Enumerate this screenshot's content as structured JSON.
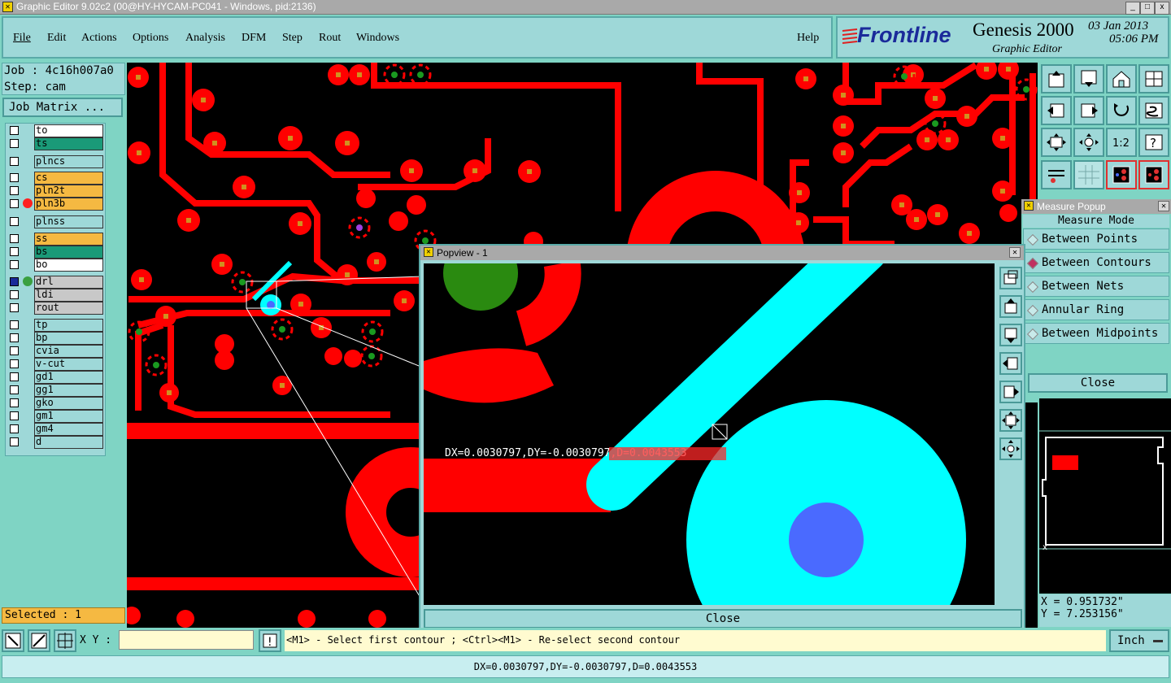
{
  "window": {
    "title": "Graphic Editor 9.02c2 (00@HY-HYCAM-PC041 - Windows, pid:2136)",
    "controls": [
      "_",
      "□",
      "x"
    ]
  },
  "menu": {
    "items": [
      "File",
      "Edit",
      "Actions",
      "Options",
      "Analysis",
      "DFM",
      "Step",
      "Rout",
      "Windows"
    ],
    "help": "Help"
  },
  "brand": {
    "logo": "Frontline",
    "product": "Genesis 2000",
    "subtitle": "Graphic Editor",
    "date": "03 Jan 2013",
    "time": "05:06 PM"
  },
  "job": {
    "job_label": "Job : 4c16h007a0",
    "step_label": "Step: cam",
    "matrix_button": "Job Matrix ..."
  },
  "layers": {
    "groups": [
      [
        {
          "name": "to",
          "color": "#ffffff"
        },
        {
          "name": "ts",
          "color": "#1a9a78"
        }
      ],
      [
        {
          "name": "plncs",
          "color": "#9ed8d8"
        }
      ],
      [
        {
          "name": "cs",
          "color": "#f5b942"
        },
        {
          "name": "pln2t",
          "color": "#f5b942"
        },
        {
          "name": "pln3b",
          "color": "#f5b942",
          "dot": "#ff2020"
        }
      ],
      [
        {
          "name": "plnss",
          "color": "#9ed8d8"
        }
      ],
      [
        {
          "name": "ss",
          "color": "#f5b942"
        },
        {
          "name": "bs",
          "color": "#1a9a78"
        },
        {
          "name": "bo",
          "color": "#ffffff"
        }
      ],
      [
        {
          "name": "drl",
          "color": "#c8c8c8",
          "active": true
        },
        {
          "name": "ldi",
          "color": "#c8c8c8"
        },
        {
          "name": "rout",
          "color": "#c8c8c8"
        }
      ],
      [
        {
          "name": "tp",
          "color": "#9ed8d8"
        },
        {
          "name": "bp",
          "color": "#9ed8d8"
        },
        {
          "name": "cvia",
          "color": "#9ed8d8"
        },
        {
          "name": "v-cut",
          "color": "#9ed8d8"
        },
        {
          "name": "gd1",
          "color": "#9ed8d8"
        },
        {
          "name": "gg1",
          "color": "#9ed8d8"
        },
        {
          "name": "gko",
          "color": "#9ed8d8"
        },
        {
          "name": "gm1",
          "color": "#9ed8d8"
        },
        {
          "name": "gm4",
          "color": "#9ed8d8"
        },
        {
          "name": "d",
          "color": "#9ed8d8"
        }
      ]
    ]
  },
  "selected": "Selected : 1",
  "measure": {
    "title": "Measure Popup",
    "mode_label": "Measure Mode",
    "options": [
      {
        "label": "Between Points",
        "selected": false
      },
      {
        "label": "Between Contours",
        "selected": true
      },
      {
        "label": "Between Nets",
        "selected": false
      },
      {
        "label": "Annular Ring",
        "selected": false
      },
      {
        "label": "Between Midpoints",
        "selected": false
      }
    ],
    "close": "Close"
  },
  "coords": {
    "x": "X = 0.951732\"",
    "y": "Y = 7.253156\""
  },
  "popview": {
    "title": "Popview - 1",
    "measurement": "DX=0.0030797,DY=-0.0030797,D=0.0043553",
    "close": "Close"
  },
  "bottom": {
    "xy_label": "X Y :",
    "xy_value": "",
    "prompt": "<M1> - Select first contour ; <Ctrl><M1> - Re-select second contour",
    "units": "Inch",
    "status": "DX=0.0030797,DY=-0.0030797,D=0.0043553"
  },
  "colors": {
    "panel": "#9ed8d8",
    "panel_border": "#5aaaa8",
    "board_red": "#ff0000",
    "cyan": "#00ffff",
    "selected_yellow": "#f5b942"
  }
}
